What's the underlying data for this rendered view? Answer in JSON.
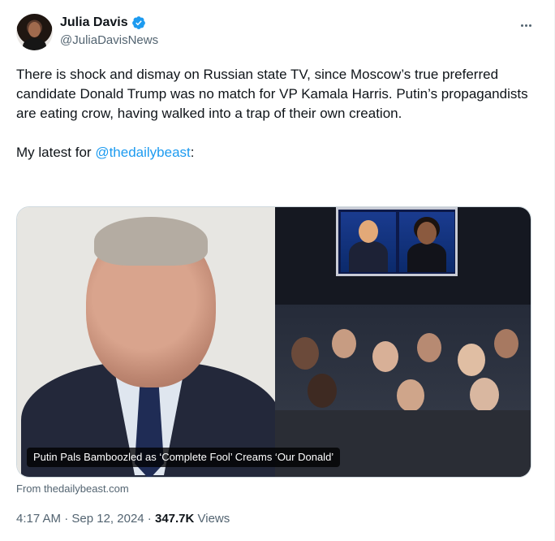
{
  "author": {
    "display_name": "Julia Davis",
    "handle": "@JuliaDavisNews"
  },
  "icons": {
    "verified": "verified-badge-icon",
    "more": "more-options-icon"
  },
  "colors": {
    "accent": "#1d9bf0",
    "text_primary": "#0f1419",
    "text_secondary": "#536471"
  },
  "tweet": {
    "paragraph_1": "There is shock and dismay on Russian state TV, since Moscow’s true preferred candidate Donald Trump was no match for VP Kamala Harris. Putin’s propagandists are eating crow, having walked into a trap of their own creation.",
    "paragraph_2_prefix": "My latest for ",
    "mention": "@thedailybeast",
    "paragraph_2_suffix": ":"
  },
  "card": {
    "caption": "Putin Pals Bamboozled as ‘Complete Fool’ Creams ‘Our Donald’",
    "source": "From thedailybeast.com"
  },
  "meta": {
    "time": "4:17 AM",
    "separator_1": " · ",
    "date": "Sep 12, 2024",
    "separator_2": " · ",
    "views_count": "347.7K",
    "views_label": " Views"
  }
}
